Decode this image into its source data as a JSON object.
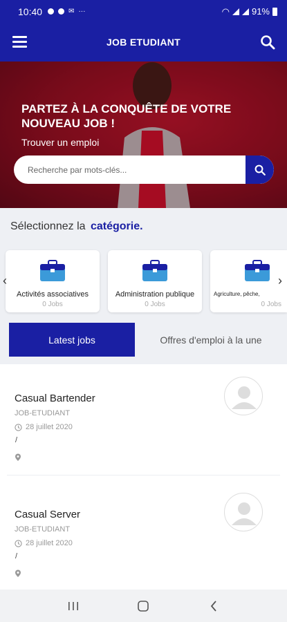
{
  "status_bar": {
    "time": "10:40",
    "battery": "91%"
  },
  "app_bar": {
    "title": "JOB ETUDIANT"
  },
  "hero": {
    "headline": "PARTEZ À LA CONQUÊTE DE VOTRE NOUVEAU JOB !",
    "subtitle": "Trouver un emploi",
    "search_placeholder": "Recherche par mots-clés..."
  },
  "categories": {
    "heading_prefix": "Sélectionnez la",
    "heading_accent": "catégorie.",
    "items": [
      {
        "label": "Activités associatives",
        "count": "0 Jobs"
      },
      {
        "label": "Administration publique",
        "count": "0 Jobs"
      },
      {
        "label": "Agriculture, pêche,",
        "count": "0 Jobs"
      }
    ]
  },
  "tabs": {
    "active": "Latest jobs",
    "inactive": "Offres d'emploi à la une"
  },
  "jobs": [
    {
      "title": "Casual Bartender",
      "company": "JOB-ETUDIANT",
      "date": "28 juillet 2020",
      "location": "/"
    },
    {
      "title": "Casual Server",
      "company": "JOB-ETUDIANT",
      "date": "28 juillet 2020",
      "location": "/"
    }
  ],
  "colors": {
    "primary": "#1a1fa3",
    "hero": "#8a0f1f",
    "icon_case": "#3b9ad9"
  }
}
